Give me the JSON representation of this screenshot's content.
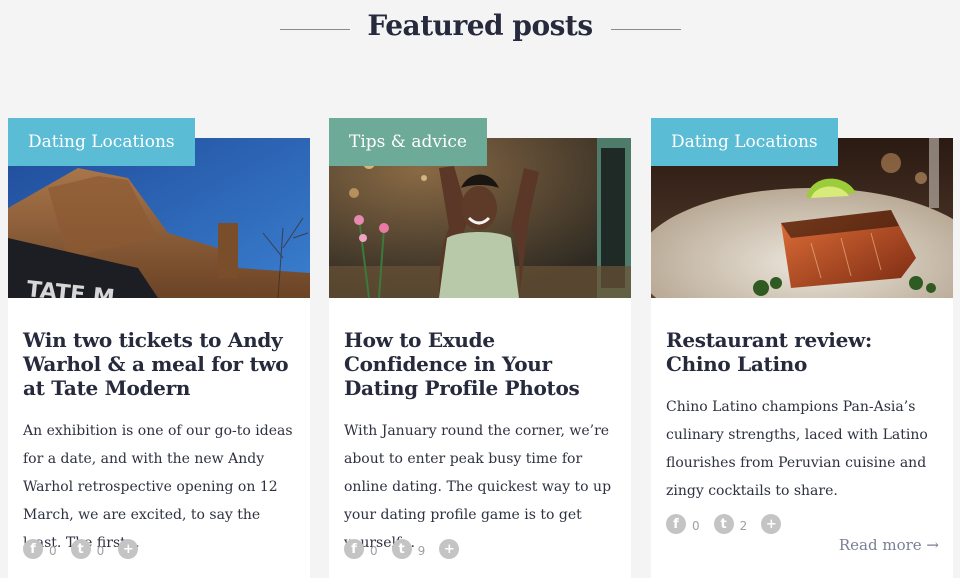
{
  "section": {
    "title": "Featured posts"
  },
  "cards": [
    {
      "category": "Dating Locations",
      "category_color": "#5bbcd6",
      "title": "Win two tickets to Andy Warhol & a meal for two at Tate Modern",
      "excerpt": "An exhibition is one of our go-to ideas for a date, and with the new Andy Warhol retrospective opening on 12 March, we are excited, to say the least. The first…",
      "image": "tate-modern-photo",
      "facebook_count": "0",
      "twitter_count": "0"
    },
    {
      "category": "Tips & advice",
      "category_color": "#6eaa98",
      "title": "How to Exude Confidence in Your Dating Profile Photos",
      "excerpt": "With January round the corner, we’re about to enter peak busy time for online dating. The quickest way to up your dating profile game is to get yourself…",
      "image": "cheering-woman-photo",
      "facebook_count": "0",
      "twitter_count": "9"
    },
    {
      "category": "Dating Locations",
      "category_color": "#5bbcd6",
      "title": "Restaurant review: Chino Latino",
      "excerpt": "Chino Latino champions Pan-Asia’s culinary strengths, laced with Latino flourishes from Peruvian cuisine and zingy cocktails to share.",
      "image": "salmon-dish-photo",
      "facebook_count": "0",
      "twitter_count": "2",
      "read_more": "Read more →"
    }
  ],
  "icons": {
    "facebook": "f",
    "twitter": "t",
    "share": "+"
  }
}
